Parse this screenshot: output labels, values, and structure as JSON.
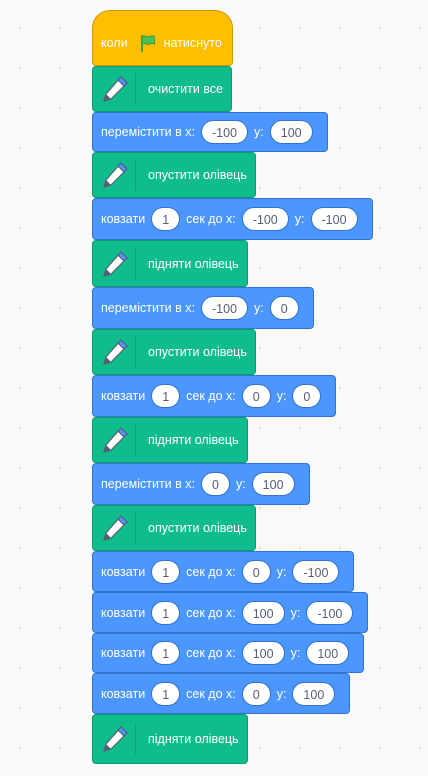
{
  "event": {
    "when_label": "коли",
    "flag_icon": "green-flag-icon",
    "clicked_label": "натиснуто"
  },
  "blocks": [
    {
      "type": "pen",
      "label": "очистити все"
    },
    {
      "type": "goto",
      "label": "перемістити в x:",
      "x": "-100",
      "y_label": "y:",
      "y": "100"
    },
    {
      "type": "pen",
      "label": "опустити олівець"
    },
    {
      "type": "glide",
      "label": "ковзати",
      "secs": "1",
      "secs_label": "сек до x:",
      "x": "-100",
      "y_label": "y:",
      "y": "-100"
    },
    {
      "type": "pen",
      "label": "підняти олівець"
    },
    {
      "type": "goto",
      "label": "перемістити в x:",
      "x": "-100",
      "y_label": "y:",
      "y": "0"
    },
    {
      "type": "pen",
      "label": "опустити олівець"
    },
    {
      "type": "glide",
      "label": "ковзати",
      "secs": "1",
      "secs_label": "сек до x:",
      "x": "0",
      "y_label": "y:",
      "y": "0"
    },
    {
      "type": "pen",
      "label": "підняти олівець"
    },
    {
      "type": "goto",
      "label": "перемістити в x:",
      "x": "0",
      "y_label": "y:",
      "y": "100"
    },
    {
      "type": "pen",
      "label": "опустити олівець"
    },
    {
      "type": "glide",
      "label": "ковзати",
      "secs": "1",
      "secs_label": "сек до x:",
      "x": "0",
      "y_label": "y:",
      "y": "-100"
    },
    {
      "type": "glide",
      "label": "ковзати",
      "secs": "1",
      "secs_label": "сек до x:",
      "x": "100",
      "y_label": "y:",
      "y": "-100"
    },
    {
      "type": "glide",
      "label": "ковзати",
      "secs": "1",
      "secs_label": "сек до x:",
      "x": "100",
      "y_label": "y:",
      "y": "100"
    },
    {
      "type": "glide",
      "label": "ковзати",
      "secs": "1",
      "secs_label": "сек до x:",
      "x": "0",
      "y_label": "y:",
      "y": "100"
    },
    {
      "type": "pen",
      "label": "підняти олівець"
    }
  ],
  "colors": {
    "event": "#ffbf00",
    "pen": "#0fbd8c",
    "motion": "#4c97ff"
  }
}
